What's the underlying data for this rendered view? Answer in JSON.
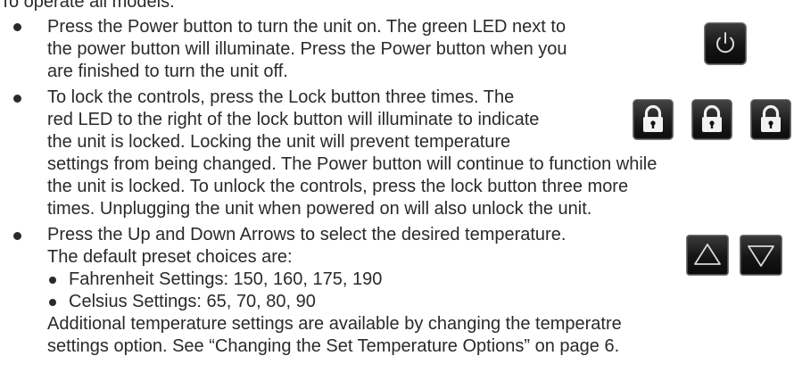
{
  "intro": "To operate all models:",
  "bullets": [
    {
      "lines": [
        "Press the Power button to turn the unit on.  The green LED next to",
        "the power button will illuminate.  Press the Power button when you",
        "are finished to turn the unit off."
      ],
      "icon": "power-icon"
    },
    {
      "lines": [
        "To lock the controls, press the Lock button three times.  The",
        "red LED to the right of the lock button will illuminate to indicate",
        "the unit is locked.  Locking the unit will prevent temperature",
        "settings from being changed.  The Power button will continue to function while",
        "the unit is locked.  To unlock the controls, press the lock button three more",
        "times.  Unplugging the unit when powered on will also unlock the unit."
      ],
      "icon": "lock-icon"
    },
    {
      "lines": [
        "Press the Up and Down Arrows to select the desired temperature.",
        "The default preset choices are:"
      ],
      "icons": [
        "up-arrow-icon",
        "down-arrow-icon"
      ],
      "subitems": [
        "Fahrenheit Settings: 150, 160, 175, 190",
        "Celsius Settings: 65, 70, 80, 90"
      ],
      "after_lines": [
        "Additional temperature settings are available by changing the temperatre",
        "settings option.  See “Changing the Set Temperature Options” on page 6."
      ]
    }
  ],
  "colors": {
    "text": "#2a2a2a",
    "button_bg": "#151515",
    "icon_stroke": "#d8d8d8",
    "lock_icon": "#f2f2f2"
  }
}
